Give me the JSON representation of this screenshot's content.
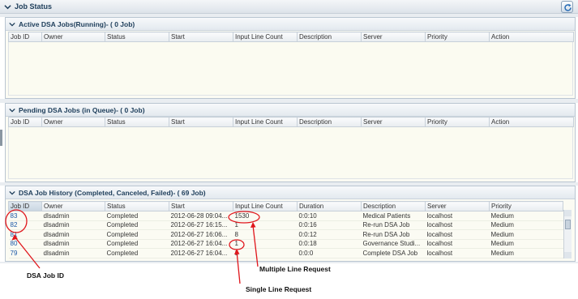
{
  "header": {
    "title": "Job Status"
  },
  "active_panel": {
    "title": "Active DSA Jobs(Running)- ( 0 Job)",
    "columns": [
      "Job ID",
      "Owner",
      "Status",
      "Start",
      "Input Line Count",
      "Description",
      "Server",
      "Priority",
      "Action"
    ]
  },
  "pending_panel": {
    "title": "Pending DSA Jobs (in Queue)- ( 0 Job)",
    "columns": [
      "Job ID",
      "Owner",
      "Status",
      "Start",
      "Input Line Count",
      "Description",
      "Server",
      "Priority",
      "Action"
    ]
  },
  "history_panel": {
    "title": "DSA Job History (Completed, Canceled, Failed)- ( 69 Job)",
    "columns": [
      "Job ID",
      "Owner",
      "Status",
      "Start",
      "Input Line Count",
      "Duration",
      "Description",
      "Server",
      "Priority"
    ],
    "rows": [
      [
        "83",
        "dlsadmin",
        "Completed",
        "2012-06-28 09:04...",
        "1530",
        "0:0:10",
        "Medical Patients",
        "localhost",
        "Medium"
      ],
      [
        "82",
        "dlsadmin",
        "Completed",
        "2012-06-27 16:15...",
        "1",
        "0:0:16",
        "Re-run DSA Job",
        "localhost",
        "Medium"
      ],
      [
        "81",
        "dlsadmin",
        "Completed",
        "2012-06-27 16:06...",
        "8",
        "0:0:12",
        "Re-run DSA Job",
        "localhost",
        "Medium"
      ],
      [
        "80",
        "dlsadmin",
        "Completed",
        "2012-06-27 16:04...",
        "1",
        "0:0:18",
        "Governance Studi...",
        "localhost",
        "Medium"
      ],
      [
        "79",
        "dlsadmin",
        "Completed",
        "2012-06-27 16:04...",
        "1",
        "0:0:0",
        "Complete DSA Job",
        "localhost",
        "Medium"
      ]
    ]
  },
  "annotations": {
    "job_id": "DSA Job ID",
    "multiple": "Multiple Line Request",
    "single": "Single Line Request"
  },
  "colors": {
    "annotation_red": "#e0161c",
    "link_blue": "#1b58a7",
    "header_text": "#1d3d5a"
  }
}
